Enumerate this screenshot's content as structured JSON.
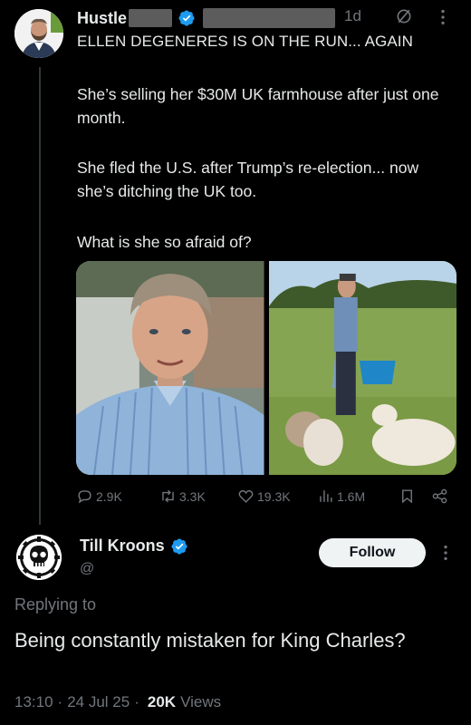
{
  "colors": {
    "background": "#000000",
    "text_primary": "#e7e9ea",
    "text_secondary": "#71767b",
    "verified_blue": "#1d9bf0",
    "follow_button_bg": "#eff3f4"
  },
  "post": {
    "author_name": "Hustle",
    "verified_icon": "verified-badge-icon",
    "time": "1d",
    "headline": "ELLEN DEGENERES IS ON THE RUN... AGAIN",
    "paragraphs": [
      "She’s selling her $30M UK farmhouse after just one month.",
      "She fled the U.S. after Trump’s re-election... now she’s ditching the UK too.",
      "What is she so afraid of?"
    ],
    "actions": {
      "replies": "2.9K",
      "reposts": "3.3K",
      "likes": "19.3K",
      "views": "1.6M"
    }
  },
  "reply": {
    "author_name": "Till Kroons",
    "handle": "@",
    "follow_label": "Follow",
    "replying_to": "Replying to",
    "text": "Being constantly mistaken for King Charles?",
    "time": "13:10",
    "date": "24 Jul 25",
    "views_count": "20K",
    "views_label": "Views"
  }
}
